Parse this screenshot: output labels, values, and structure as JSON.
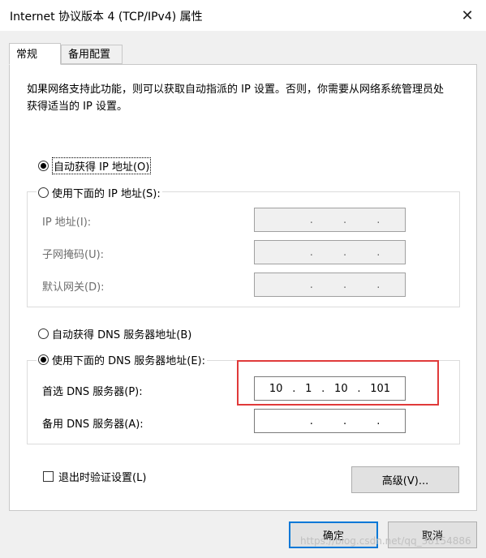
{
  "window": {
    "title": "Internet 协议版本 4 (TCP/IPv4) 属性",
    "close_glyph": "✕"
  },
  "tabs": [
    {
      "label": "常规",
      "active": true
    },
    {
      "label": "备用配置",
      "active": false
    }
  ],
  "description": "如果网络支持此功能，则可以获取自动指派的 IP 设置。否则，你需要从网络系统管理员处获得适当的 IP 设置。",
  "ip": {
    "auto_label": "自动获得 IP 地址(O)",
    "auto_selected": true,
    "manual_label": "使用下面的 IP 地址(S):",
    "manual_selected": false,
    "address_label": "IP 地址(I):",
    "mask_label": "子网掩码(U):",
    "gateway_label": "默认网关(D):",
    "dot": "."
  },
  "dns": {
    "auto_label": "自动获得 DNS 服务器地址(B)",
    "auto_selected": false,
    "manual_label": "使用下面的 DNS 服务器地址(E):",
    "manual_selected": true,
    "preferred_label": "首选 DNS 服务器(P):",
    "preferred_value": [
      "10",
      "1",
      "10",
      "101"
    ],
    "alternate_label": "备用 DNS 服务器(A):",
    "alternate_value": [
      "",
      "",
      "",
      ""
    ],
    "dot": "."
  },
  "validate_label": "退出时验证设置(L)",
  "validate_checked": false,
  "buttons": {
    "advanced": "高级(V)...",
    "ok": "确定",
    "cancel": "取消"
  },
  "watermark": "https://blog.csdn.net/qq_38154886",
  "colors": {
    "highlight": "#e03a3a",
    "accent": "#0078d7"
  }
}
